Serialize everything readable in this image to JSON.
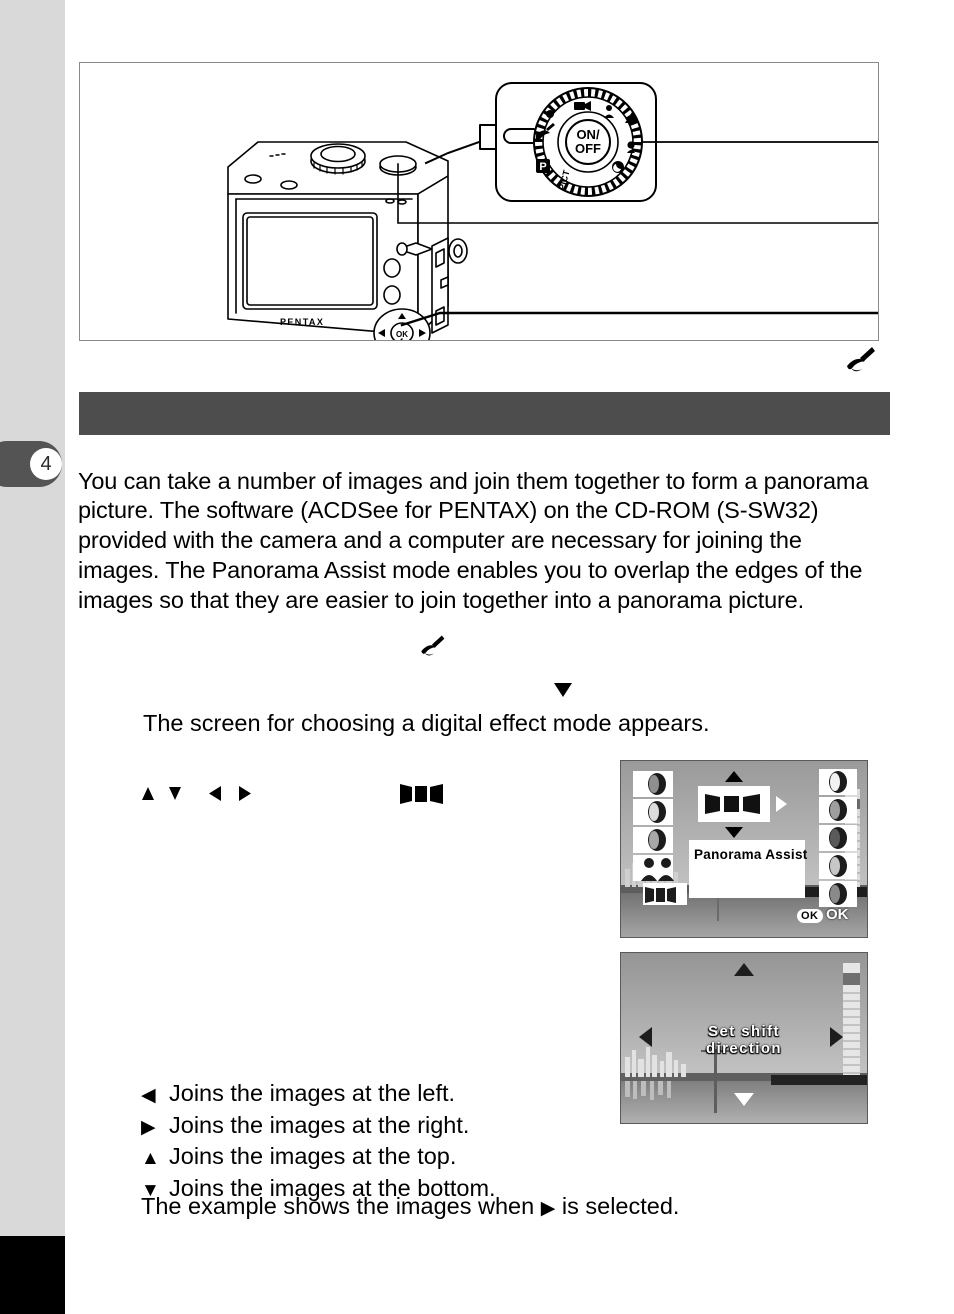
{
  "sidebar": {
    "chapter_number": "4"
  },
  "diagram": {
    "camera_brand": "PENTAX",
    "mode_dial_center_line1": "ON/",
    "mode_dial_center_line2": "OFF",
    "mode_dial_label_pict": "PICT",
    "ok_button_label": "OK"
  },
  "section": {
    "heading": ""
  },
  "body": {
    "intro_paragraph": "You can take a number of images and join them together to form a panorama picture. The software (ACDSee for PENTAX) on the CD-ROM (S-SW32) provided with the camera and a computer are necessary for joining the images. The Panorama Assist mode enables you to overlap the edges of the images so that they are easier to join together into a panorama picture.",
    "step_result_text": "The screen for choosing a digital effect mode appears."
  },
  "icons": {
    "panorama_assist_mode": "panorama-assist-mode-icon",
    "arrow_up": "▲",
    "arrow_down": "▼",
    "arrow_left": "◀",
    "arrow_right": "▶"
  },
  "directions": {
    "rows": [
      {
        "glyph": "◀",
        "text": "Joins the images at the left."
      },
      {
        "glyph": "▶",
        "text": "Joins the images at the right."
      },
      {
        "glyph": "▲",
        "text": "Joins the images at the top."
      },
      {
        "glyph": "▼",
        "text": "Joins the images at the bottom."
      }
    ],
    "example_prefix": "The example shows the images when",
    "example_glyph": "▶",
    "example_suffix": "is selected."
  },
  "lcd_menu": {
    "selected_mode_label": "Panorama Assist",
    "ok_pill_label": "OK",
    "ok_text_label": "OK"
  },
  "lcd_shift": {
    "message_line1": "Set shift",
    "message_line2": "direction"
  },
  "colors": {
    "sidebar": "#d9d9d9",
    "sidebar_bottom": "#000000",
    "chapter_tab": "#545454",
    "section_band": "#4d4d4d",
    "diagram_border": "#8a8a8a",
    "text": "#000000"
  }
}
